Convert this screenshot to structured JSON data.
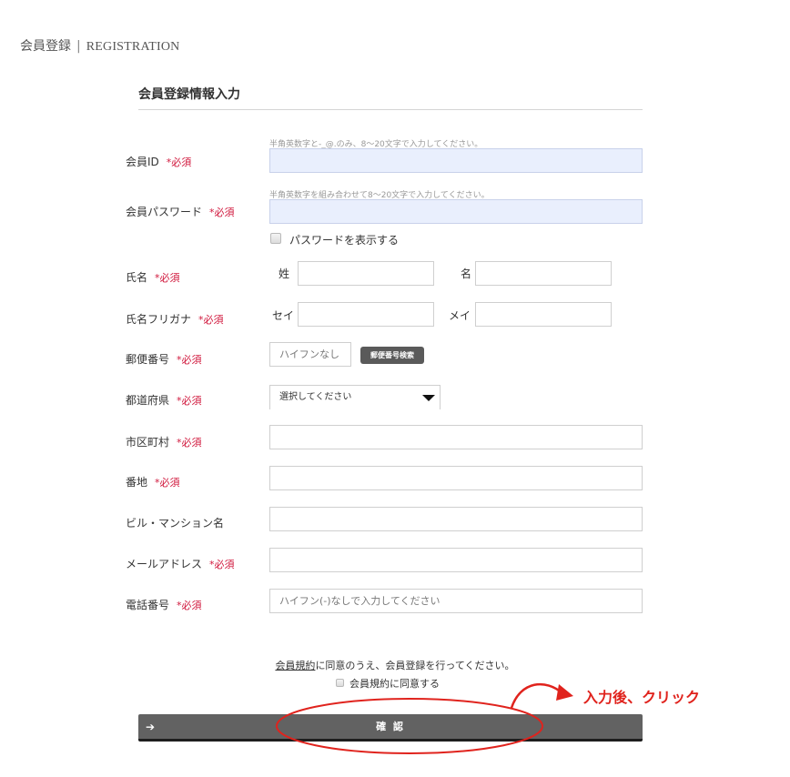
{
  "page": {
    "title_ja": "会員登録",
    "separator": "|",
    "title_en": "REGISTRATION"
  },
  "section_title": "会員登録情報入力",
  "required_mark": "*必須",
  "form": {
    "member_id": {
      "label": "会員ID",
      "hint": "半角英数字と-_@.のみ、8〜20文字で入力してください。",
      "value": ""
    },
    "password": {
      "label": "会員パスワード",
      "hint": "半角英数字を組み合わせて8〜20文字で入力してください。",
      "value": "",
      "show_password_label": "パスワードを表示する"
    },
    "name": {
      "label": "氏名",
      "last_label": "姓",
      "first_label": "名",
      "last_value": "",
      "first_value": ""
    },
    "name_kana": {
      "label": "氏名フリガナ",
      "last_label": "セイ",
      "first_label": "メイ",
      "last_value": "",
      "first_value": ""
    },
    "postal_code": {
      "label": "郵便番号",
      "placeholder": "ハイフンなし",
      "search_button": "郵便番号検索"
    },
    "prefecture": {
      "label": "都道府県",
      "selected": "選択してください"
    },
    "city": {
      "label": "市区町村",
      "value": ""
    },
    "address": {
      "label": "番地",
      "value": ""
    },
    "building": {
      "label": "ビル・マンション名",
      "value": ""
    },
    "email": {
      "label": "メールアドレス",
      "value": ""
    },
    "phone": {
      "label": "電話番号",
      "placeholder": "ハイフン(-)なしで入力してください"
    }
  },
  "agreement": {
    "terms_link": "会員規約",
    "text_rest": "に同意のうえ、会員登録を行ってください。",
    "checkbox_label": "会員規約に同意する"
  },
  "confirm_button": {
    "arrow": "➔",
    "label": "確 認"
  },
  "annotation": {
    "text": "入力後、クリック",
    "color": "#e0231d"
  }
}
